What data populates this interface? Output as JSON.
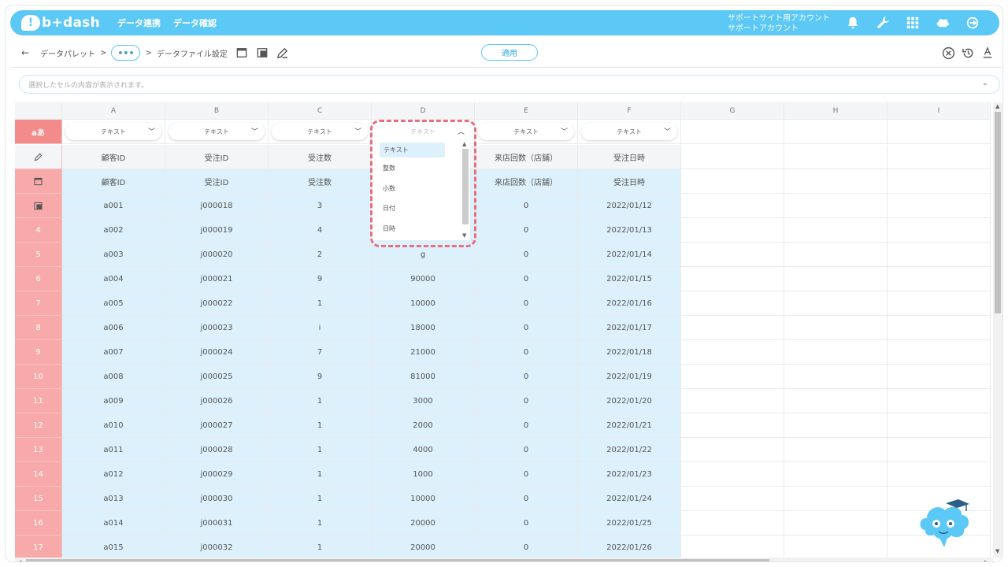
{
  "nav": {
    "brand": "b+dash",
    "links": [
      "データ連携",
      "データ確認"
    ],
    "account_line1": "サポートサイト用アカウント",
    "account_line2": "サポートアカウント"
  },
  "breadcrumb": {
    "back": "←",
    "item1": "データパレット",
    "sep": ">",
    "dots": "•••",
    "item2": "データファイル設定"
  },
  "apply_label": "適用",
  "cellbar_placeholder": "選択したセルの内容が表示されます。",
  "grid": {
    "columns": [
      "A",
      "B",
      "C",
      "D",
      "E",
      "F",
      "G",
      "H",
      "I"
    ],
    "type_row_label": "aあ",
    "types": [
      "テキスト",
      "テキスト",
      "テキスト",
      "テキスト",
      "テキスト",
      "テキスト"
    ],
    "names_row": [
      "顧客ID",
      "受注ID",
      "受注数",
      "",
      "来店回数（店舗）",
      "受注日時"
    ],
    "header_row": [
      "顧客ID",
      "受注ID",
      "受注数",
      "",
      "来店回数（店舗）",
      "受注日時"
    ],
    "data_rows": [
      {
        "num": "",
        "cells": [
          "a001",
          "j000018",
          "3",
          "",
          "0",
          "2022/01/12"
        ]
      },
      {
        "num": "4",
        "cells": [
          "a002",
          "j000019",
          "4",
          "",
          "0",
          "2022/01/13"
        ]
      },
      {
        "num": "5",
        "cells": [
          "a003",
          "j000020",
          "2",
          "g",
          "0",
          "2022/01/14"
        ]
      },
      {
        "num": "6",
        "cells": [
          "a004",
          "j000021",
          "9",
          "90000",
          "0",
          "2022/01/15"
        ]
      },
      {
        "num": "7",
        "cells": [
          "a005",
          "j000022",
          "1",
          "10000",
          "0",
          "2022/01/16"
        ]
      },
      {
        "num": "8",
        "cells": [
          "a006",
          "j000023",
          "i",
          "18000",
          "0",
          "2022/01/17"
        ]
      },
      {
        "num": "9",
        "cells": [
          "a007",
          "j000024",
          "7",
          "21000",
          "0",
          "2022/01/18"
        ]
      },
      {
        "num": "10",
        "cells": [
          "a008",
          "j000025",
          "9",
          "81000",
          "0",
          "2022/01/19"
        ]
      },
      {
        "num": "11",
        "cells": [
          "a009",
          "j000026",
          "1",
          "3000",
          "0",
          "2022/01/20"
        ]
      },
      {
        "num": "12",
        "cells": [
          "a010",
          "j000027",
          "1",
          "2000",
          "0",
          "2022/01/21"
        ]
      },
      {
        "num": "13",
        "cells": [
          "a011",
          "j000028",
          "1",
          "4000",
          "0",
          "2022/01/22"
        ]
      },
      {
        "num": "14",
        "cells": [
          "a012",
          "j000029",
          "1",
          "1000",
          "0",
          "2022/01/23"
        ]
      },
      {
        "num": "15",
        "cells": [
          "a013",
          "j000030",
          "1",
          "10000",
          "0",
          "2022/01/24"
        ]
      },
      {
        "num": "16",
        "cells": [
          "a014",
          "j000031",
          "1",
          "20000",
          "0",
          "2022/01/25"
        ]
      },
      {
        "num": "17",
        "cells": [
          "a015",
          "j000032",
          "1",
          "20000",
          "0",
          "2022/01/26"
        ]
      }
    ]
  },
  "type_dropdown": {
    "options": [
      "テキスト",
      "整数",
      "小数",
      "日付",
      "日時"
    ],
    "selected": "テキスト"
  },
  "colors": {
    "accent": "#5bc8f5",
    "row_header": "#f7aaa9",
    "cell_blue": "#dcf1fb",
    "highlight": "#e96f7d"
  }
}
